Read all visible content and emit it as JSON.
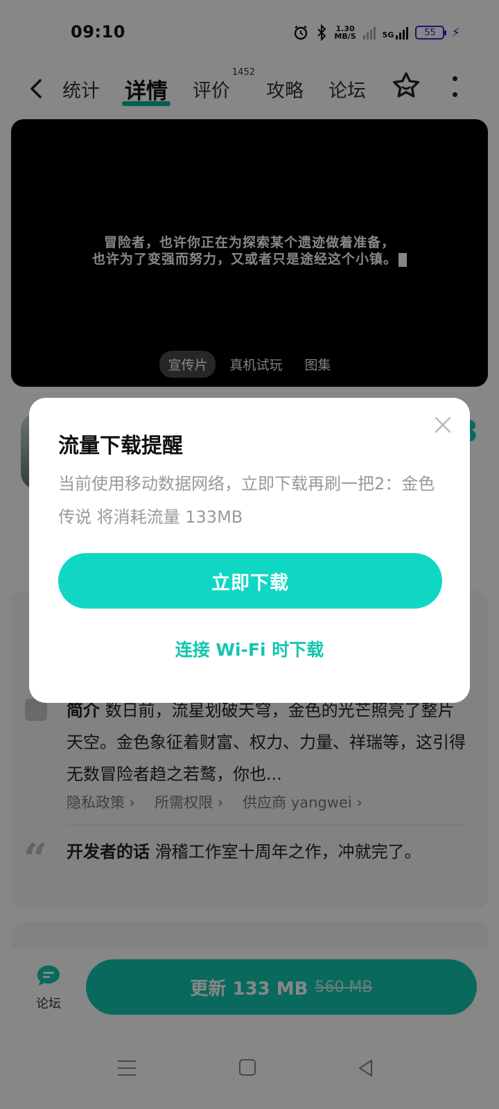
{
  "status_bar": {
    "time": "09:10",
    "net_speed_value": "1.30",
    "net_speed_unit": "MB/S",
    "network": "5G",
    "battery": "55"
  },
  "nav": {
    "tabs": [
      {
        "label": "统计"
      },
      {
        "label": "详情"
      },
      {
        "label": "评价",
        "badge": "1452"
      },
      {
        "label": "攻略"
      },
      {
        "label": "论坛"
      }
    ],
    "active_tab": "详情"
  },
  "video": {
    "subtitle_line1": "冒险者，也许你正在为探索某个遗迹做着准备，",
    "subtitle_line2": "也许为了变强而努力，又或者只是途经这个小镇。",
    "media_tabs": [
      "宣传片",
      "真机试玩",
      "图集"
    ],
    "active_media_tab": "宣传片"
  },
  "app": {
    "rating_fragment": "3"
  },
  "description": {
    "label": "简介",
    "text_line1": "数日前，流星划破天穹，金色的光芒照亮",
    "text_rest": "了整片天空。金色象征着财富、权力、力量、祥瑞等，这引得无数冒险者趋之若鹜，你也...",
    "links": [
      "隐私政策 ›",
      "所需权限 ›",
      "供应商 yangwei ›"
    ]
  },
  "developer": {
    "label": "开发者的话",
    "text": "滑稽工作室十周年之作，冲就完了。"
  },
  "bottom_bar": {
    "forum_label": "论坛",
    "update_label": "更新 133 MB",
    "update_old_size": "560 MB"
  },
  "dialog": {
    "title": "流量下载提醒",
    "message": "当前使用移动数据网络，立即下载再刷一把2：金色传说 将消耗流量 133MB",
    "primary_button": "立即下载",
    "secondary_button": "连接 Wi-Fi 时下载"
  },
  "colors": {
    "accent": "#12c6b0",
    "primary_button": "#10d7c3",
    "overlay": "rgba(0,0,0,0.47)"
  }
}
